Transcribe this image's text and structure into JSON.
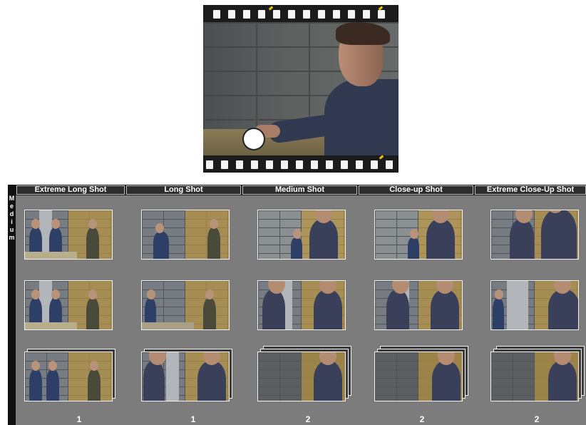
{
  "preview": {
    "caption": ""
  },
  "row_label": {
    "letters": [
      "M",
      "e",
      "d",
      "i",
      "u",
      "m"
    ]
  },
  "columns": [
    {
      "label": "Extreme Long Shot",
      "count": "1"
    },
    {
      "label": "Long Shot",
      "count": "1"
    },
    {
      "label": "Medium Shot",
      "count": "2"
    },
    {
      "label": "Close-up Shot",
      "count": "2"
    },
    {
      "label": "Extreme Close-Up Shot",
      "count": "2"
    }
  ],
  "colors": {
    "board_bg": "#7c7c7c",
    "header_bg": "#2d2d2d",
    "amber_overlay": "#be963c"
  }
}
